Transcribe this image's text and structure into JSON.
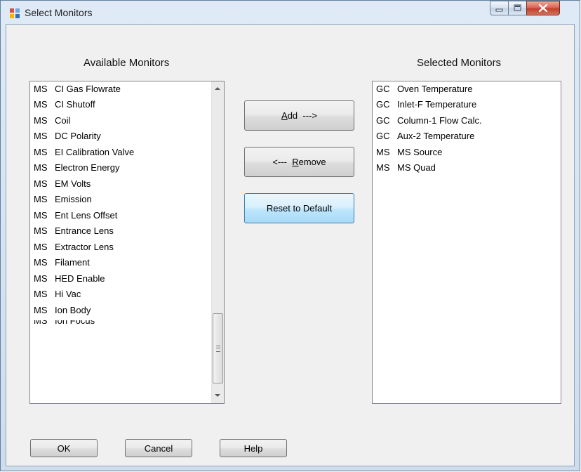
{
  "window": {
    "title": "Select Monitors",
    "controls": {
      "minimize": "minimize-icon",
      "maximize": "maximize-icon",
      "close": "close-icon"
    }
  },
  "available": {
    "label": "Available Monitors",
    "items": [
      {
        "code": "MS",
        "name": "CI Gas Flowrate"
      },
      {
        "code": "MS",
        "name": "CI Shutoff"
      },
      {
        "code": "MS",
        "name": "Coil"
      },
      {
        "code": "MS",
        "name": "DC Polarity"
      },
      {
        "code": "MS",
        "name": "EI Calibration Valve"
      },
      {
        "code": "MS",
        "name": "Electron Energy"
      },
      {
        "code": "MS",
        "name": "EM Volts"
      },
      {
        "code": "MS",
        "name": "Emission"
      },
      {
        "code": "MS",
        "name": "Ent Lens Offset"
      },
      {
        "code": "MS",
        "name": "Entrance Lens"
      },
      {
        "code": "MS",
        "name": "Extractor Lens"
      },
      {
        "code": "MS",
        "name": "Filament"
      },
      {
        "code": "MS",
        "name": "HED Enable"
      },
      {
        "code": "MS",
        "name": "Hi Vac"
      },
      {
        "code": "MS",
        "name": "Ion Body"
      },
      {
        "code": "MS",
        "name": "Ion Focus"
      }
    ]
  },
  "selected": {
    "label": "Selected Monitors",
    "items": [
      {
        "code": "GC",
        "name": "Oven Temperature"
      },
      {
        "code": "GC",
        "name": "Inlet-F Temperature"
      },
      {
        "code": "GC",
        "name": "Column-1 Flow Calc."
      },
      {
        "code": "GC",
        "name": "Aux-2 Temperature"
      },
      {
        "code": "MS",
        "name": "MS Source"
      },
      {
        "code": "MS",
        "name": "MS Quad"
      }
    ]
  },
  "buttons": {
    "add_mnemonic": "A",
    "add_rest": "dd  --->",
    "remove_prefix": "<---  ",
    "remove_mnemonic": "R",
    "remove_rest": "emove",
    "reset": "Reset to Default",
    "ok": "OK",
    "cancel": "Cancel",
    "help": "Help"
  },
  "colors": {
    "accent": "#3c7fb1",
    "close": "#c7402b"
  }
}
